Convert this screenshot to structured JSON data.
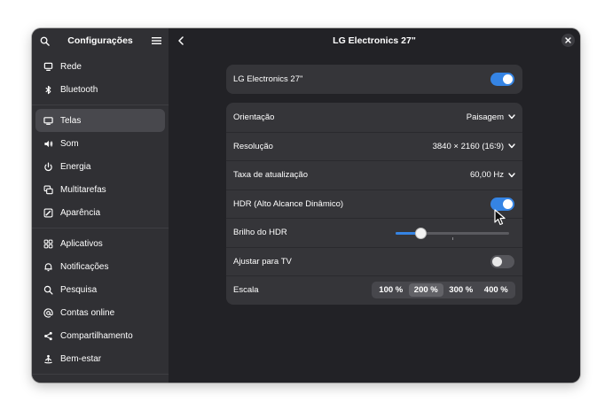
{
  "sidebar": {
    "title": "Configurações",
    "groups": [
      [
        {
          "label": "Rede",
          "icon": "desktop-icon"
        },
        {
          "label": "Bluetooth",
          "icon": "bluetooth-icon"
        }
      ],
      [
        {
          "label": "Telas",
          "icon": "display-icon",
          "active": true
        },
        {
          "label": "Som",
          "icon": "speaker-icon"
        },
        {
          "label": "Energia",
          "icon": "power-icon"
        },
        {
          "label": "Multitarefas",
          "icon": "multitasking-icon"
        },
        {
          "label": "Aparência",
          "icon": "appearance-icon"
        }
      ],
      [
        {
          "label": "Aplicativos",
          "icon": "apps-grid-icon"
        },
        {
          "label": "Notificações",
          "icon": "bell-icon"
        },
        {
          "label": "Pesquisa",
          "icon": "search-icon"
        },
        {
          "label": "Contas online",
          "icon": "at-sign-icon"
        },
        {
          "label": "Compartilhamento",
          "icon": "share-icon"
        },
        {
          "label": "Bem-estar",
          "icon": "wellbeing-icon"
        }
      ]
    ]
  },
  "content": {
    "title": "LG Electronics 27\"",
    "monitor_row": {
      "label": "LG Electronics 27\"",
      "enabled": true
    },
    "rows": {
      "orientation": {
        "label": "Orientação",
        "value": "Paisagem"
      },
      "resolution": {
        "label": "Resolução",
        "value": "3840 × 2160 (16∶9)"
      },
      "refresh": {
        "label": "Taxa de atualização",
        "value": "60,00 Hz"
      },
      "hdr": {
        "label": "HDR (Alto Alcance Dinâmico)",
        "enabled": true
      },
      "hdr_brightness": {
        "label": "Brilho do HDR",
        "level": 0.22
      },
      "tv_adjust": {
        "label": "Ajustar para TV",
        "enabled": false
      },
      "scale": {
        "label": "Escala",
        "options": [
          "100 %",
          "200 %",
          "300 %",
          "400 %"
        ],
        "selected": "200 %"
      }
    }
  },
  "colors": {
    "accent": "#3584e4",
    "sidebar_bg": "#303034",
    "content_bg": "#222226",
    "card_bg": "#353539"
  }
}
